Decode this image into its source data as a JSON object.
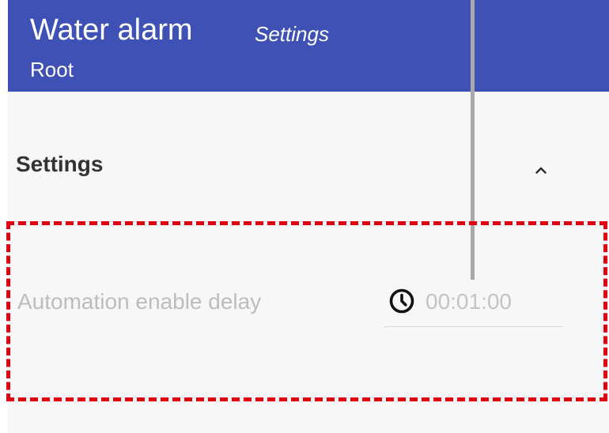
{
  "header": {
    "title": "Water alarm",
    "subtitle": "Settings",
    "breadcrumb": "Root",
    "background_color": "#3f51b5"
  },
  "section": {
    "title": "Settings",
    "toggle_icon": "chevron-up-icon"
  },
  "settings": [
    {
      "label": "Automation enable delay",
      "icon": "clock-icon",
      "value": "00:01:00"
    }
  ],
  "overlay": {
    "highlight_color": "#e0000f",
    "line_color": "#a8a8a8"
  }
}
